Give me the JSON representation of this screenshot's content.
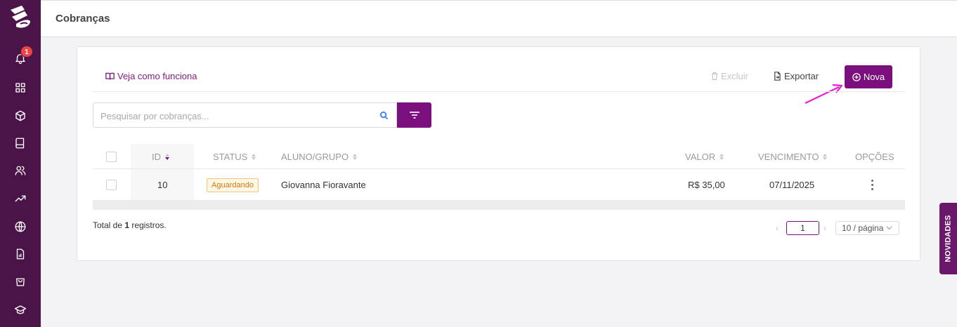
{
  "header": {
    "title": "Cobranças"
  },
  "sidebar": {
    "notification_count": "1",
    "items": [
      {
        "icon": "bell-icon"
      },
      {
        "icon": "dashboard-grid-icon"
      },
      {
        "icon": "box-icon"
      },
      {
        "icon": "book-icon"
      },
      {
        "icon": "users-icon"
      },
      {
        "icon": "trending-up-icon"
      },
      {
        "icon": "globe-icon"
      },
      {
        "icon": "report-icon"
      },
      {
        "icon": "shopping-bag-icon"
      },
      {
        "icon": "graduation-cap-icon"
      }
    ]
  },
  "toolbar": {
    "help_link": "Veja como funciona",
    "delete_label": "Excluir",
    "export_label": "Exportar",
    "new_label": "Nova"
  },
  "search": {
    "placeholder": "Pesquisar por cobranças..."
  },
  "table": {
    "columns": [
      "ID",
      "STATUS",
      "ALUNO/GRUPO",
      "VALOR",
      "VENCIMENTO",
      "OPÇÕES"
    ],
    "rows": [
      {
        "id": "10",
        "status": "Aguardando",
        "aluno": "Giovanna Fioravante",
        "valor": "R$ 35,00",
        "vencimento": "07/11/2025"
      }
    ]
  },
  "footer": {
    "total_prefix": "Total de",
    "total_count": "1",
    "total_suffix": "registros.",
    "current_page": "1",
    "page_size": "10 / página"
  },
  "novidades_label": "NOVIDADES",
  "colors": {
    "primary": "#7b0f7e",
    "sidebar": "#4a1448",
    "badge": "#ef4444",
    "status_warning": "#d97706"
  }
}
